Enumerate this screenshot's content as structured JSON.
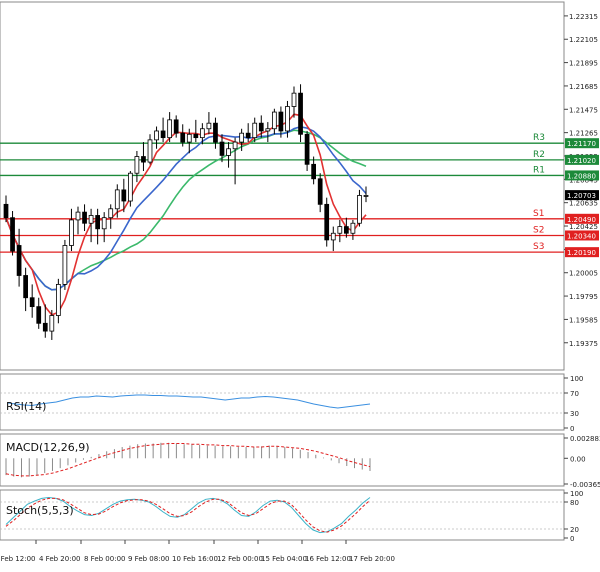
{
  "chart_data": {
    "type": "candlestick",
    "main": {
      "ylim": [
        1.1913,
        1.2244
      ],
      "price_ticks": [
        "1.22315",
        "1.22105",
        "1.21895",
        "1.21685",
        "1.21475",
        "1.21265",
        "1.21055",
        "1.20845",
        "1.20635",
        "1.20425",
        "1.20215",
        "1.20005",
        "1.19795",
        "1.19585",
        "1.19375"
      ],
      "levels": [
        {
          "name": "R3",
          "value": 1.2117,
          "label": "1.21170",
          "kind": "resistance"
        },
        {
          "name": "R2",
          "value": 1.2102,
          "label": "1.21020",
          "kind": "resistance"
        },
        {
          "name": "R1",
          "value": 1.2088,
          "label": "1.20880",
          "kind": "resistance"
        },
        {
          "name": "S1",
          "value": 1.2049,
          "label": "1.20490",
          "kind": "support"
        },
        {
          "name": "S2",
          "value": 1.2034,
          "label": "1.20340",
          "kind": "support"
        },
        {
          "name": "S3",
          "value": 1.2019,
          "label": "1.20190",
          "kind": "support"
        }
      ],
      "current_price": {
        "value": 1.20703,
        "label": "1.20703"
      },
      "candles": [
        {
          "o": 1.2062,
          "h": 1.207,
          "l": 1.2046,
          "c": 1.205
        },
        {
          "o": 1.205,
          "h": 1.2056,
          "l": 1.2016,
          "c": 1.202
        },
        {
          "o": 1.2025,
          "h": 1.204,
          "l": 1.1988,
          "c": 1.1998
        },
        {
          "o": 1.1998,
          "h": 1.2005,
          "l": 1.1966,
          "c": 1.1978
        },
        {
          "o": 1.1978,
          "h": 1.199,
          "l": 1.196,
          "c": 1.197
        },
        {
          "o": 1.197,
          "h": 1.1978,
          "l": 1.195,
          "c": 1.1955
        },
        {
          "o": 1.1955,
          "h": 1.1972,
          "l": 1.1942,
          "c": 1.1948
        },
        {
          "o": 1.1948,
          "h": 1.1967,
          "l": 1.194,
          "c": 1.1962
        },
        {
          "o": 1.1962,
          "h": 1.1995,
          "l": 1.1955,
          "c": 1.199
        },
        {
          "o": 1.199,
          "h": 1.203,
          "l": 1.1985,
          "c": 1.2025
        },
        {
          "o": 1.2025,
          "h": 1.2058,
          "l": 1.202,
          "c": 1.2048
        },
        {
          "o": 1.2048,
          "h": 1.206,
          "l": 1.2035,
          "c": 1.2055
        },
        {
          "o": 1.2055,
          "h": 1.2062,
          "l": 1.2038,
          "c": 1.2045
        },
        {
          "o": 1.2045,
          "h": 1.2058,
          "l": 1.2028,
          "c": 1.2052
        },
        {
          "o": 1.2052,
          "h": 1.2058,
          "l": 1.2026,
          "c": 1.204
        },
        {
          "o": 1.204,
          "h": 1.2055,
          "l": 1.2028,
          "c": 1.205
        },
        {
          "o": 1.205,
          "h": 1.2062,
          "l": 1.204,
          "c": 1.2058
        },
        {
          "o": 1.2058,
          "h": 1.208,
          "l": 1.205,
          "c": 1.2075
        },
        {
          "o": 1.2075,
          "h": 1.2085,
          "l": 1.2055,
          "c": 1.2065
        },
        {
          "o": 1.2065,
          "h": 1.2092,
          "l": 1.206,
          "c": 1.209
        },
        {
          "o": 1.209,
          "h": 1.211,
          "l": 1.2082,
          "c": 1.2105
        },
        {
          "o": 1.2105,
          "h": 1.2118,
          "l": 1.2092,
          "c": 1.21
        },
        {
          "o": 1.21,
          "h": 1.2125,
          "l": 1.2098,
          "c": 1.212
        },
        {
          "o": 1.212,
          "h": 1.2132,
          "l": 1.2112,
          "c": 1.2128
        },
        {
          "o": 1.2128,
          "h": 1.214,
          "l": 1.2118,
          "c": 1.2122
        },
        {
          "o": 1.2122,
          "h": 1.2145,
          "l": 1.2118,
          "c": 1.2138
        },
        {
          "o": 1.2138,
          "h": 1.2142,
          "l": 1.2122,
          "c": 1.2126
        },
        {
          "o": 1.2126,
          "h": 1.2134,
          "l": 1.2114,
          "c": 1.2118
        },
        {
          "o": 1.2118,
          "h": 1.213,
          "l": 1.2108,
          "c": 1.2125
        },
        {
          "o": 1.2125,
          "h": 1.2138,
          "l": 1.2118,
          "c": 1.2122
        },
        {
          "o": 1.2122,
          "h": 1.2135,
          "l": 1.2116,
          "c": 1.213
        },
        {
          "o": 1.213,
          "h": 1.2145,
          "l": 1.2125,
          "c": 1.2135
        },
        {
          "o": 1.2135,
          "h": 1.214,
          "l": 1.2112,
          "c": 1.2118
        },
        {
          "o": 1.2118,
          "h": 1.2125,
          "l": 1.21,
          "c": 1.2106
        },
        {
          "o": 1.2106,
          "h": 1.2118,
          "l": 1.2095,
          "c": 1.2112
        },
        {
          "o": 1.2112,
          "h": 1.2122,
          "l": 1.208,
          "c": 1.2118
        },
        {
          "o": 1.2118,
          "h": 1.213,
          "l": 1.211,
          "c": 1.2126
        },
        {
          "o": 1.2126,
          "h": 1.2135,
          "l": 1.2118,
          "c": 1.2122
        },
        {
          "o": 1.2122,
          "h": 1.214,
          "l": 1.2118,
          "c": 1.2135
        },
        {
          "o": 1.2135,
          "h": 1.2142,
          "l": 1.2122,
          "c": 1.2128
        },
        {
          "o": 1.2128,
          "h": 1.2136,
          "l": 1.2118,
          "c": 1.213
        },
        {
          "o": 1.213,
          "h": 1.2148,
          "l": 1.2125,
          "c": 1.2145
        },
        {
          "o": 1.2145,
          "h": 1.215,
          "l": 1.2122,
          "c": 1.2128
        },
        {
          "o": 1.2128,
          "h": 1.2155,
          "l": 1.2122,
          "c": 1.215
        },
        {
          "o": 1.215,
          "h": 1.2168,
          "l": 1.214,
          "c": 1.2162
        },
        {
          "o": 1.2162,
          "h": 1.217,
          "l": 1.2118,
          "c": 1.2125
        },
        {
          "o": 1.2125,
          "h": 1.2128,
          "l": 1.2092,
          "c": 1.2098
        },
        {
          "o": 1.2098,
          "h": 1.2105,
          "l": 1.208,
          "c": 1.2085
        },
        {
          "o": 1.2085,
          "h": 1.209,
          "l": 1.2055,
          "c": 1.2062
        },
        {
          "o": 1.2062,
          "h": 1.2068,
          "l": 1.2024,
          "c": 1.203
        },
        {
          "o": 1.203,
          "h": 1.2042,
          "l": 1.202,
          "c": 1.2036
        },
        {
          "o": 1.2036,
          "h": 1.2048,
          "l": 1.2028,
          "c": 1.2042
        },
        {
          "o": 1.2042,
          "h": 1.205,
          "l": 1.2032,
          "c": 1.2036
        },
        {
          "o": 1.2036,
          "h": 1.2048,
          "l": 1.203,
          "c": 1.2045
        },
        {
          "o": 1.2045,
          "h": 1.2075,
          "l": 1.2042,
          "c": 1.207
        },
        {
          "o": 1.207,
          "h": 1.2078,
          "l": 1.2064,
          "c": 1.207
        }
      ]
    },
    "x_labels": [
      "2 Feb 12:00",
      "4 Feb 20:00",
      "8 Feb 00:00",
      "9 Feb 08:00",
      "10 Feb 16:00",
      "12 Feb 00:00",
      "15 Feb 04:00",
      "16 Feb 12:00",
      "17 Feb 20:00"
    ],
    "rsi": {
      "label": "RSI(14)",
      "ticks": [
        "100",
        "70",
        "30",
        "0"
      ],
      "ylim": [
        0,
        100
      ],
      "values": [
        50,
        48,
        46,
        45,
        48,
        50,
        52,
        56,
        60,
        62,
        62,
        64,
        63,
        62,
        64,
        65,
        66,
        66,
        65,
        65,
        64,
        64,
        63,
        62,
        62,
        60,
        58,
        56,
        58,
        60,
        60,
        62,
        63,
        62,
        60,
        58,
        56,
        52,
        48,
        45,
        42,
        40,
        42,
        44,
        46,
        48
      ]
    },
    "macd": {
      "label": "MACD(12,26,9)",
      "ticks": [
        "0.002883",
        "0.00",
        "-0.003654"
      ],
      "ylim": [
        -0.003654,
        0.002883
      ],
      "histogram": [
        -0.0024,
        -0.0026,
        -0.0027,
        -0.0026,
        -0.0024,
        -0.0021,
        -0.0018,
        -0.0014,
        -0.001,
        -0.0006,
        -0.0002,
        0.0002,
        0.0006,
        0.001,
        0.0013,
        0.0016,
        0.0018,
        0.002,
        0.0021,
        0.0021,
        0.0022,
        0.0022,
        0.0021,
        0.002,
        0.002,
        0.0019,
        0.0018,
        0.0018,
        0.0017,
        0.0017,
        0.0016,
        0.0016,
        0.0016,
        0.0017,
        0.0018,
        0.0017,
        0.0016,
        0.0014,
        0.0012,
        0.0009,
        0.0005,
        0.0001,
        -0.0003,
        -0.0007,
        -0.0011,
        -0.0014,
        -0.0016,
        -0.0018
      ],
      "signal": [
        -0.0022,
        -0.0024,
        -0.0025,
        -0.0025,
        -0.0024,
        -0.0023,
        -0.0021,
        -0.0018,
        -0.0015,
        -0.0011,
        -0.0007,
        -0.0003,
        0.0001,
        0.0005,
        0.0008,
        0.0011,
        0.0014,
        0.0016,
        0.0018,
        0.0019,
        0.002,
        0.0021,
        0.0021,
        0.0021,
        0.002,
        0.002,
        0.0019,
        0.0019,
        0.0018,
        0.0018,
        0.0017,
        0.0017,
        0.0016,
        0.0016,
        0.0017,
        0.0017,
        0.0016,
        0.0015,
        0.0014,
        0.0012,
        0.001,
        0.0007,
        0.0004,
        0.0001,
        -0.0003,
        -0.0006,
        -0.0009,
        -0.0012
      ]
    },
    "stoch": {
      "label": "Stoch(5,5,3)",
      "ticks": [
        "100",
        "80",
        "20",
        "0"
      ],
      "ylim": [
        0,
        100
      ],
      "main": [
        30,
        45,
        60,
        75,
        82,
        88,
        90,
        88,
        82,
        70,
        60,
        52,
        50,
        55,
        65,
        75,
        82,
        85,
        86,
        84,
        80,
        70,
        58,
        48,
        46,
        52,
        65,
        78,
        86,
        88,
        85,
        76,
        62,
        50,
        48,
        58,
        72,
        82,
        84,
        80,
        68,
        50,
        32,
        18,
        12,
        14,
        22,
        32,
        48,
        62,
        78,
        90
      ],
      "signal": [
        26,
        38,
        52,
        66,
        76,
        84,
        88,
        88,
        85,
        76,
        66,
        56,
        52,
        53,
        60,
        70,
        78,
        83,
        85,
        85,
        82,
        75,
        65,
        54,
        48,
        50,
        58,
        70,
        80,
        86,
        86,
        80,
        68,
        56,
        50,
        54,
        65,
        76,
        82,
        82,
        74,
        58,
        40,
        25,
        16,
        13,
        18,
        27,
        40,
        54,
        70,
        84
      ]
    }
  }
}
